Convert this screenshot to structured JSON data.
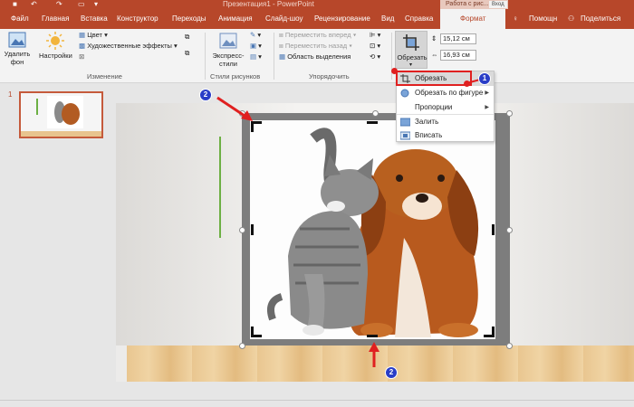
{
  "window": {
    "title": "Презентация1 - PowerPoint",
    "context_group": "Работа с рис...",
    "login": "Вход"
  },
  "qat": [
    "save-icon",
    "undo-icon",
    "redo-icon",
    "slideshow-icon",
    "customize-icon"
  ],
  "tabs": [
    {
      "label": "Файл"
    },
    {
      "label": "Главная"
    },
    {
      "label": "Вставка"
    },
    {
      "label": "Конструктор"
    },
    {
      "label": "Переходы"
    },
    {
      "label": "Анимация"
    },
    {
      "label": "Слайд-шоу"
    },
    {
      "label": "Рецензирование"
    },
    {
      "label": "Вид"
    },
    {
      "label": "Справка"
    },
    {
      "label": "Формат",
      "active": true
    }
  ],
  "help": {
    "label": "Помощн"
  },
  "share": {
    "label": "Поделиться"
  },
  "ribbon": {
    "remove_bg": "Удалить фон",
    "corrections": "Настройки",
    "color": "Цвет",
    "artistic": "Художественные эффекты",
    "group_adjust": "Изменение",
    "express_styles": "Экспресс-стили",
    "group_styles": "Стили рисунков",
    "bring_forward": "Переместить вперед",
    "send_backward": "Переместить назад",
    "selection_pane": "Область выделения",
    "group_arrange": "Упорядочить",
    "crop": "Обрезать",
    "height": "15,12 см",
    "width": "16,93 см"
  },
  "crop_menu": [
    {
      "label": "Обрезать",
      "icon": "crop-icon",
      "highlighted": true
    },
    {
      "label": "Обрезать по фигуре",
      "icon": "crop-shape-icon",
      "submenu": true
    },
    {
      "label": "Пропорции",
      "icon": "",
      "submenu": true
    },
    {
      "label": "Залить",
      "icon": "fill-icon"
    },
    {
      "label": "Вписать",
      "icon": "fit-icon"
    }
  ],
  "slides": {
    "current_number": "1"
  },
  "annotations": [
    "1",
    "2",
    "2"
  ],
  "colors": {
    "accent": "#b7472a",
    "highlight_red": "#e02020",
    "badge_blue": "#2a3ec7",
    "green_line": "#6db044"
  }
}
